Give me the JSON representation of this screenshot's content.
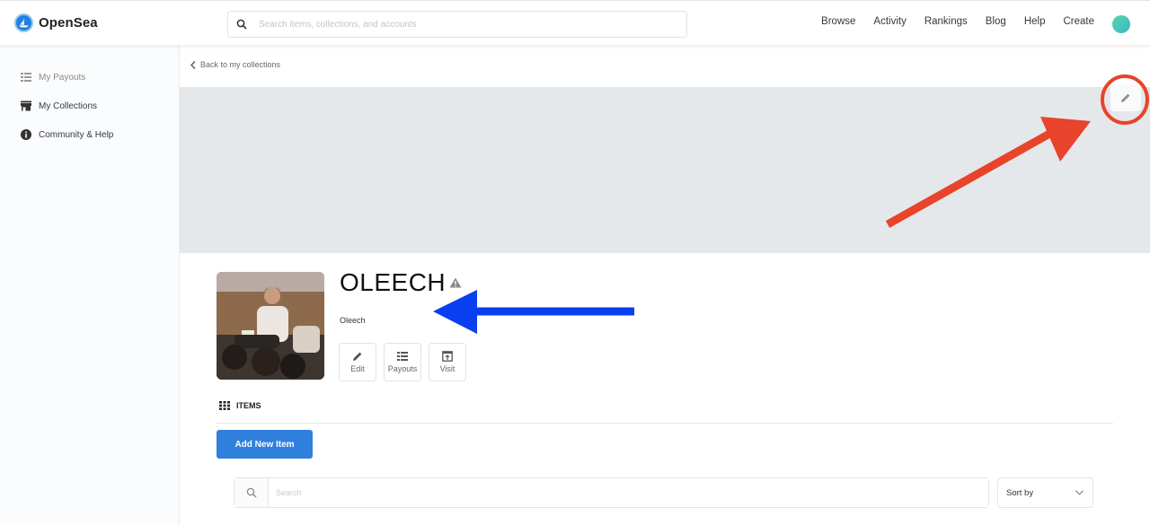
{
  "header": {
    "brand": "OpenSea",
    "search_placeholder": "Search items, collections, and accounts",
    "nav": [
      "Browse",
      "Activity",
      "Rankings",
      "Blog",
      "Help",
      "Create"
    ]
  },
  "sidebar": {
    "items": [
      {
        "label": "My Payouts",
        "icon": "list-icon"
      },
      {
        "label": "My Collections",
        "icon": "storefront-icon"
      },
      {
        "label": "Community & Help",
        "icon": "info-icon"
      }
    ]
  },
  "main": {
    "back_link": "Back to my collections",
    "collection": {
      "title": "OLEECH",
      "subtitle": "Oleech",
      "actions": [
        "Edit",
        "Payouts",
        "Visit"
      ]
    },
    "items_heading": "ITEMS",
    "add_item_label": "Add New Item",
    "search_placeholder": "Search",
    "sort_label": "Sort by"
  },
  "annotations": {
    "red_color": "#e8432b",
    "blue_color": "#0a3ff0"
  }
}
